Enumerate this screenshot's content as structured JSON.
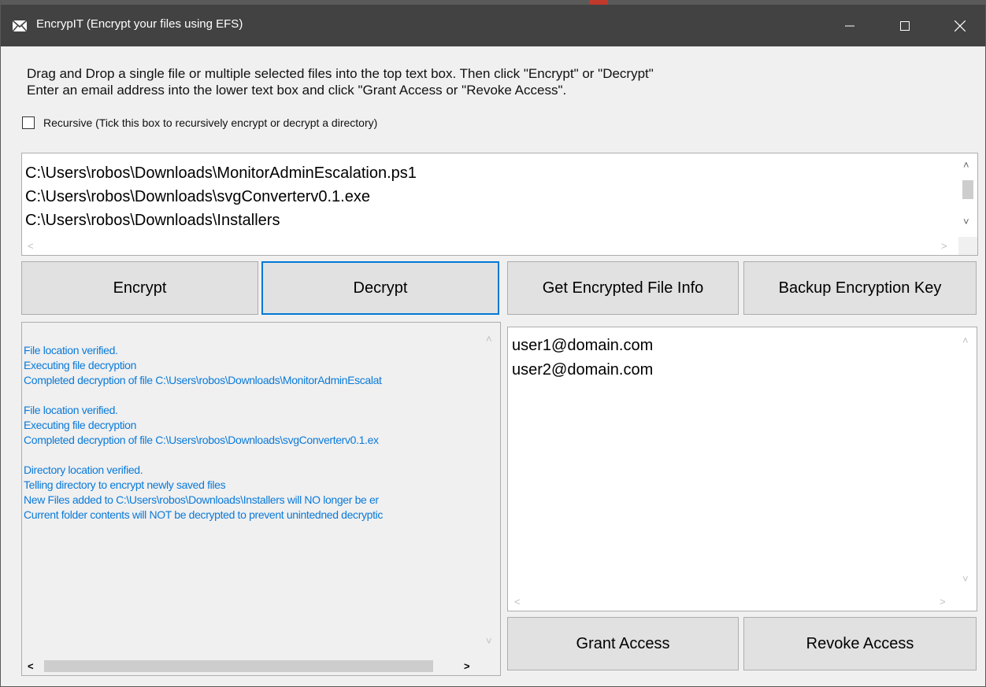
{
  "window": {
    "title": "EncrypIT (Encrypt your files using EFS)"
  },
  "instructions": {
    "line1": "Drag and Drop a single file or multiple selected files into the top text box. Then click \"Encrypt\" or \"Decrypt\"",
    "line2": "Enter an email address into the lower text box and click \"Grant Access or \"Revoke Access\"."
  },
  "recursive": {
    "label": "Recursive (Tick this box to recursively encrypt or decrypt a directory)",
    "checked": false
  },
  "files": [
    "C:\\Users\\robos\\Downloads\\MonitorAdminEscalation.ps1",
    "C:\\Users\\robos\\Downloads\\svgConverterv0.1.exe",
    "C:\\Users\\robos\\Downloads\\Installers"
  ],
  "buttons": {
    "encrypt": "Encrypt",
    "decrypt": "Decrypt",
    "get_info": "Get Encrypted File Info",
    "backup_key": "Backup Encryption Key",
    "grant": "Grant Access",
    "revoke": "Revoke Access"
  },
  "log": [
    "File location verified.",
    "Executing file decryption",
    "Completed decryption of file C:\\Users\\robos\\Downloads\\MonitorAdminEscalat",
    "",
    "File location verified.",
    "Executing file decryption",
    "Completed decryption of file C:\\Users\\robos\\Downloads\\svgConverterv0.1.ex",
    "",
    "Directory location verified.",
    "Telling directory to encrypt newly saved files",
    "New Files added to C:\\Users\\robos\\Downloads\\Installers will NO longer be er",
    "Current folder contents will NOT be decrypted to prevent unintedned decryptic"
  ],
  "emails": [
    "user1@domain.com",
    "user2@domain.com"
  ],
  "colors": {
    "titlebar": "#424242",
    "log_text": "#0a7ad9",
    "focus_border": "#0078d7"
  }
}
